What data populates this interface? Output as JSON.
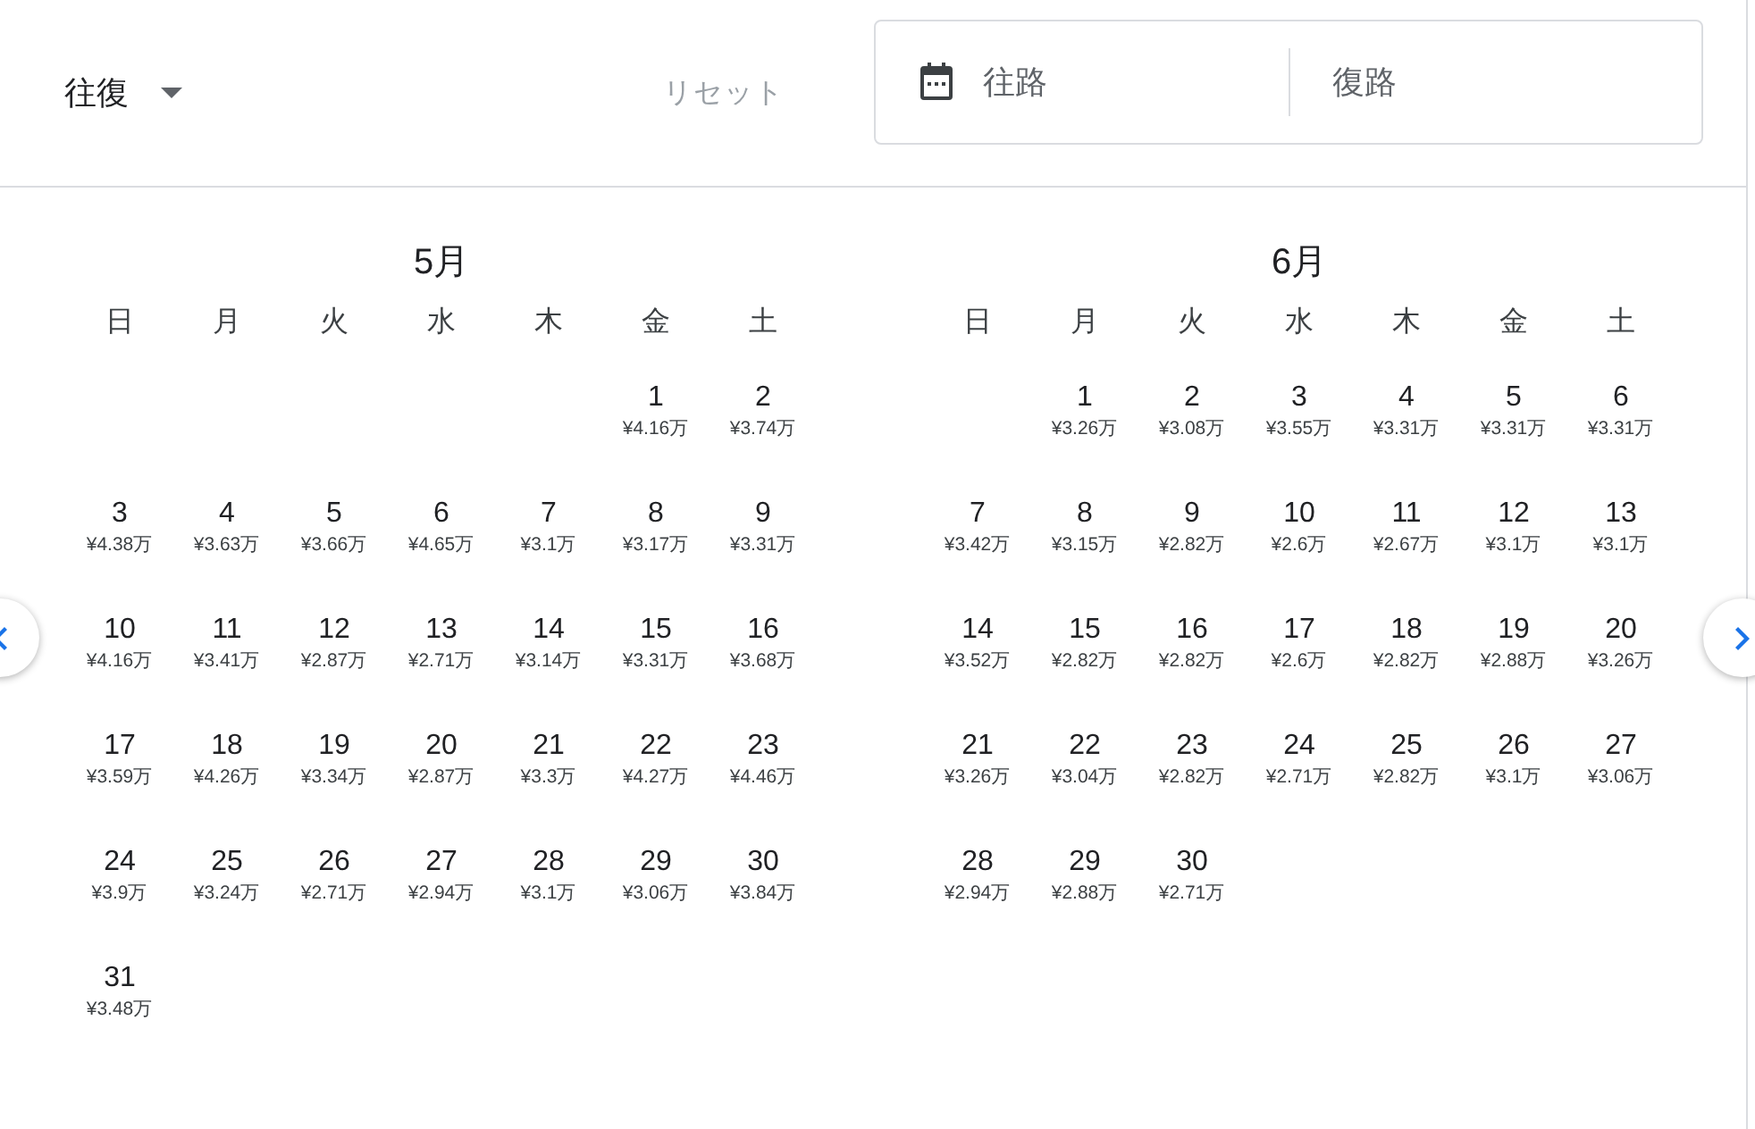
{
  "trip_type": {
    "label": "往復"
  },
  "reset": {
    "label": "リセット",
    "disabled": true
  },
  "date_field": {
    "departure": {
      "placeholder": "往路"
    },
    "return": {
      "placeholder": "復路"
    }
  },
  "months": [
    {
      "title": "5月",
      "weekdays": [
        "日",
        "月",
        "火",
        "水",
        "木",
        "金",
        "土"
      ],
      "weeks": [
        [
          {
            "kind": "blank"
          },
          {
            "kind": "blank"
          },
          {
            "kind": "blank"
          },
          {
            "kind": "blank"
          },
          {
            "kind": "blank"
          },
          {
            "kind": "day",
            "day": "1",
            "price": "¥4.16万"
          },
          {
            "kind": "day",
            "day": "2",
            "price": "¥3.74万"
          }
        ],
        [
          {
            "kind": "day",
            "day": "3",
            "price": "¥4.38万"
          },
          {
            "kind": "day",
            "day": "4",
            "price": "¥3.63万"
          },
          {
            "kind": "day",
            "day": "5",
            "price": "¥3.66万"
          },
          {
            "kind": "day",
            "day": "6",
            "price": "¥4.65万"
          },
          {
            "kind": "day",
            "day": "7",
            "price": "¥3.1万"
          },
          {
            "kind": "day",
            "day": "8",
            "price": "¥3.17万"
          },
          {
            "kind": "day",
            "day": "9",
            "price": "¥3.31万"
          }
        ],
        [
          {
            "kind": "day",
            "day": "10",
            "price": "¥4.16万"
          },
          {
            "kind": "day",
            "day": "11",
            "price": "¥3.41万"
          },
          {
            "kind": "day",
            "day": "12",
            "price": "¥2.87万"
          },
          {
            "kind": "day",
            "day": "13",
            "price": "¥2.71万"
          },
          {
            "kind": "day",
            "day": "14",
            "price": "¥3.14万"
          },
          {
            "kind": "day",
            "day": "15",
            "price": "¥3.31万"
          },
          {
            "kind": "day",
            "day": "16",
            "price": "¥3.68万"
          }
        ],
        [
          {
            "kind": "day",
            "day": "17",
            "price": "¥3.59万"
          },
          {
            "kind": "day",
            "day": "18",
            "price": "¥4.26万"
          },
          {
            "kind": "day",
            "day": "19",
            "price": "¥3.34万"
          },
          {
            "kind": "day",
            "day": "20",
            "price": "¥2.87万"
          },
          {
            "kind": "day",
            "day": "21",
            "price": "¥3.3万"
          },
          {
            "kind": "day",
            "day": "22",
            "price": "¥4.27万"
          },
          {
            "kind": "day",
            "day": "23",
            "price": "¥4.46万"
          }
        ],
        [
          {
            "kind": "day",
            "day": "24",
            "price": "¥3.9万"
          },
          {
            "kind": "day",
            "day": "25",
            "price": "¥3.24万"
          },
          {
            "kind": "day",
            "day": "26",
            "price": "¥2.71万"
          },
          {
            "kind": "day",
            "day": "27",
            "price": "¥2.94万"
          },
          {
            "kind": "day",
            "day": "28",
            "price": "¥3.1万"
          },
          {
            "kind": "day",
            "day": "29",
            "price": "¥3.06万"
          },
          {
            "kind": "day",
            "day": "30",
            "price": "¥3.84万"
          }
        ],
        [
          {
            "kind": "day",
            "day": "31",
            "price": "¥3.48万"
          }
        ]
      ]
    },
    {
      "title": "6月",
      "weekdays": [
        "日",
        "月",
        "火",
        "水",
        "木",
        "金",
        "土"
      ],
      "weeks": [
        [
          {
            "kind": "blank"
          },
          {
            "kind": "day",
            "day": "1",
            "price": "¥3.26万"
          },
          {
            "kind": "day",
            "day": "2",
            "price": "¥3.08万"
          },
          {
            "kind": "day",
            "day": "3",
            "price": "¥3.55万"
          },
          {
            "kind": "day",
            "day": "4",
            "price": "¥3.31万"
          },
          {
            "kind": "day",
            "day": "5",
            "price": "¥3.31万"
          },
          {
            "kind": "day",
            "day": "6",
            "price": "¥3.31万"
          }
        ],
        [
          {
            "kind": "day",
            "day": "7",
            "price": "¥3.42万"
          },
          {
            "kind": "day",
            "day": "8",
            "price": "¥3.15万"
          },
          {
            "kind": "day",
            "day": "9",
            "price": "¥2.82万"
          },
          {
            "kind": "day",
            "day": "10",
            "price": "¥2.6万"
          },
          {
            "kind": "day",
            "day": "11",
            "price": "¥2.67万"
          },
          {
            "kind": "day",
            "day": "12",
            "price": "¥3.1万"
          },
          {
            "kind": "day",
            "day": "13",
            "price": "¥3.1万"
          }
        ],
        [
          {
            "kind": "day",
            "day": "14",
            "price": "¥3.52万"
          },
          {
            "kind": "day",
            "day": "15",
            "price": "¥2.82万"
          },
          {
            "kind": "day",
            "day": "16",
            "price": "¥2.82万"
          },
          {
            "kind": "day",
            "day": "17",
            "price": "¥2.6万"
          },
          {
            "kind": "day",
            "day": "18",
            "price": "¥2.82万"
          },
          {
            "kind": "day",
            "day": "19",
            "price": "¥2.88万"
          },
          {
            "kind": "day",
            "day": "20",
            "price": "¥3.26万"
          }
        ],
        [
          {
            "kind": "day",
            "day": "21",
            "price": "¥3.26万"
          },
          {
            "kind": "day",
            "day": "22",
            "price": "¥3.04万"
          },
          {
            "kind": "day",
            "day": "23",
            "price": "¥2.82万"
          },
          {
            "kind": "day",
            "day": "24",
            "price": "¥2.71万"
          },
          {
            "kind": "day",
            "day": "25",
            "price": "¥2.82万"
          },
          {
            "kind": "day",
            "day": "26",
            "price": "¥3.1万"
          },
          {
            "kind": "day",
            "day": "27",
            "price": "¥3.06万"
          }
        ],
        [
          {
            "kind": "day",
            "day": "28",
            "price": "¥2.94万"
          },
          {
            "kind": "day",
            "day": "29",
            "price": "¥2.88万"
          },
          {
            "kind": "day",
            "day": "30",
            "price": "¥2.71万"
          }
        ]
      ]
    }
  ]
}
